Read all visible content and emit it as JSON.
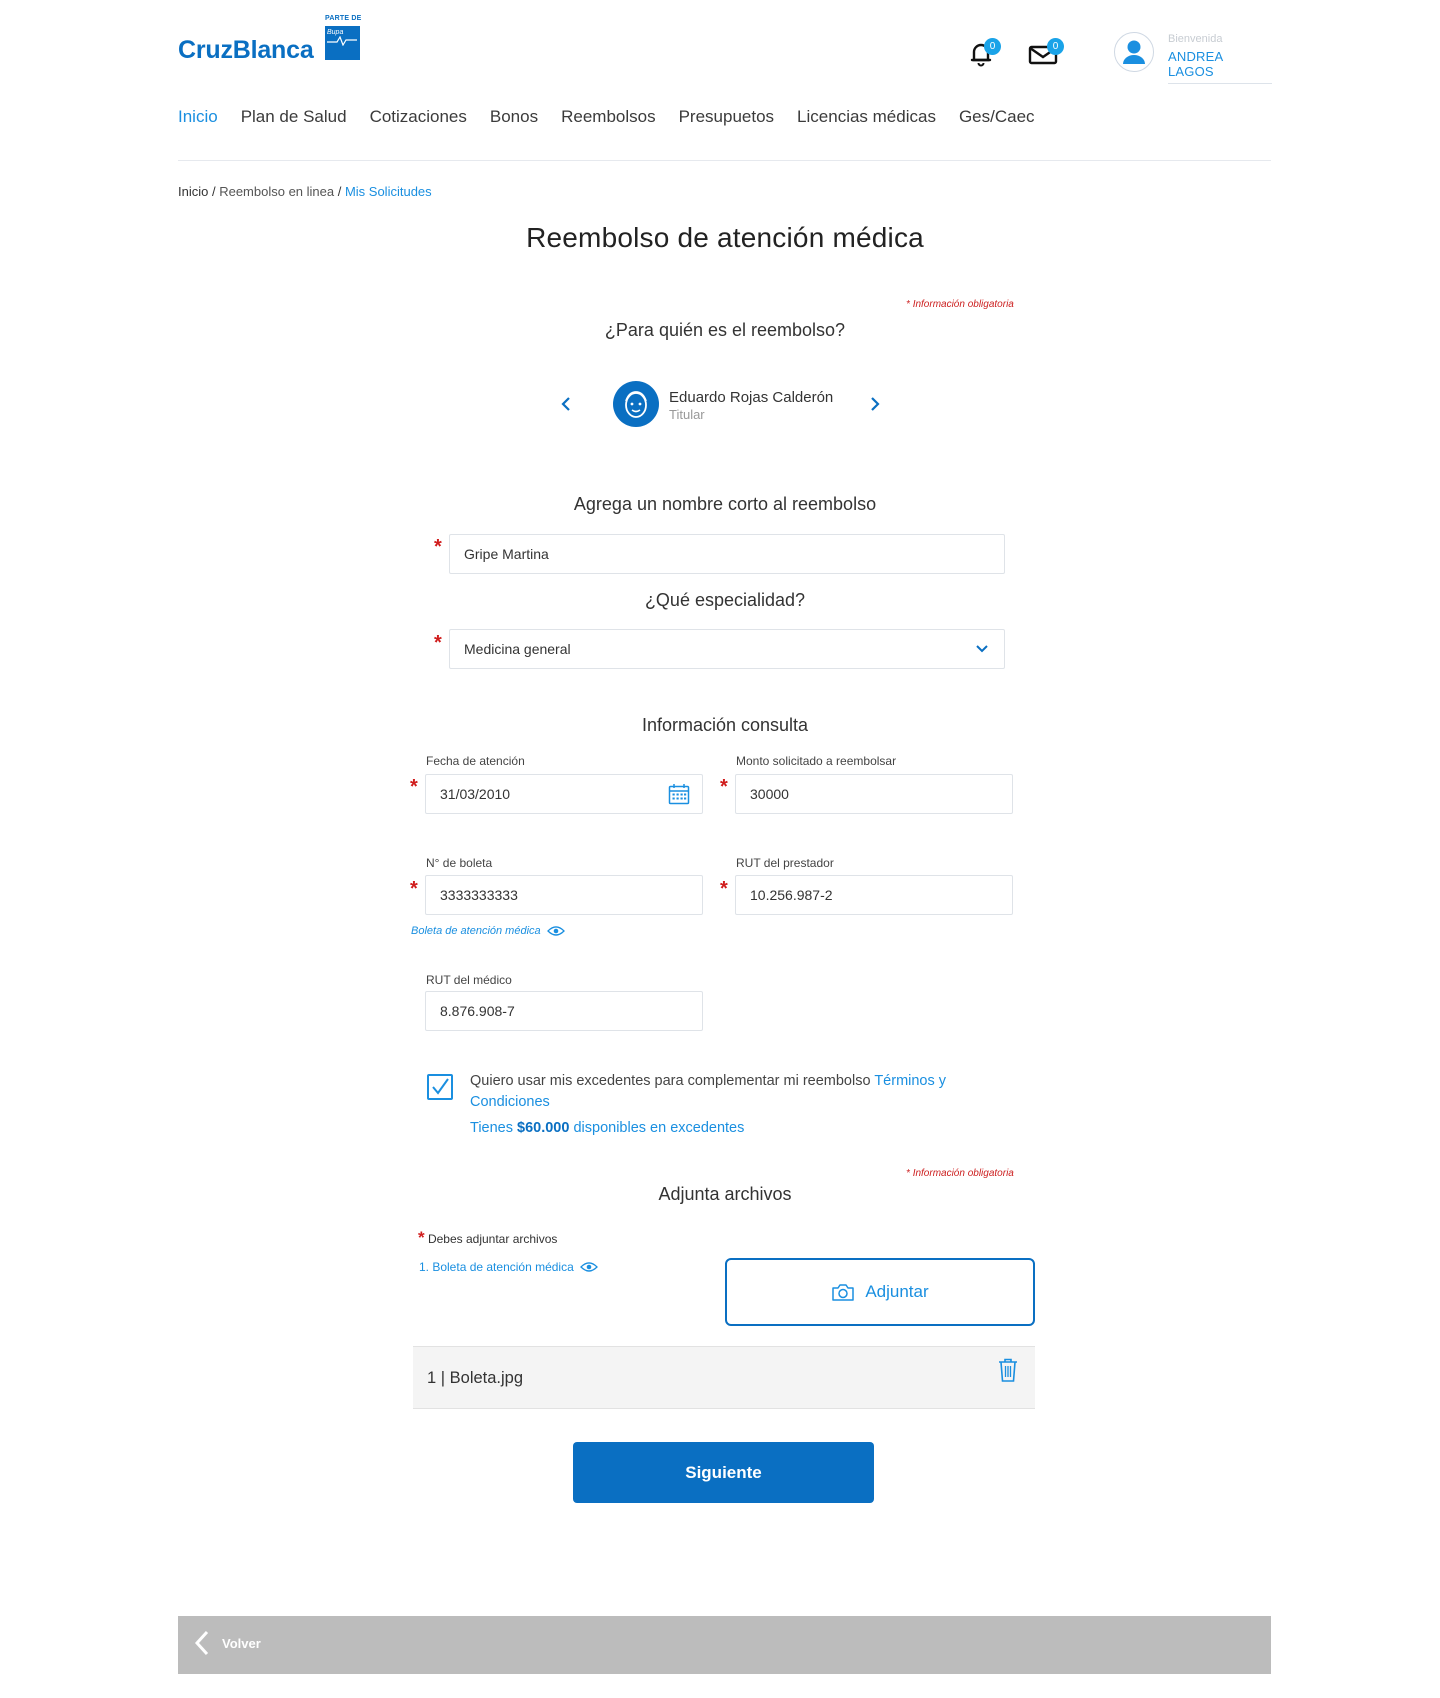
{
  "brand": {
    "logo_text": "CruzBlanca",
    "parte_de": "PARTE DE",
    "bupa": "Bupa"
  },
  "header": {
    "notifications_count": "0",
    "messages_count": "0",
    "welcome": "Bienvenida",
    "user_name": "ANDREA LAGOS"
  },
  "nav": {
    "items": [
      "Inicio",
      "Plan de Salud",
      "Cotizaciones",
      "Bonos",
      "Reembolsos",
      "Presupuetos",
      "Licencias médicas",
      "Ges/Caec"
    ]
  },
  "breadcrumb": {
    "home": "Inicio",
    "sep": " / ",
    "middle": "Reembolso en linea",
    "current": "Mis Solicitudes"
  },
  "page_title": "Reembolso de atención médica",
  "required_note": {
    "asterisk": "*",
    "text": "Información obligatoria"
  },
  "beneficiary": {
    "question": "¿Para quién es el reembolso?",
    "name": "Eduardo Rojas Calderón",
    "role": "Titular"
  },
  "short_name": {
    "title": "Agrega un nombre corto al reembolso",
    "value": "Gripe Martina"
  },
  "specialty": {
    "title": "¿Qué especialidad?",
    "value": "Medicina general"
  },
  "consulta": {
    "title": "Información consulta",
    "fecha_label": "Fecha de atención",
    "fecha_value": "31/03/2010",
    "monto_label": "Monto solicitado a reembolsar",
    "monto_value": "30000",
    "boleta_label": "N° de boleta",
    "boleta_value": "3333333333",
    "boleta_link": "Boleta de atención médica",
    "rut_prestador_label": "RUT del prestador",
    "rut_prestador_value": "10.256.987-2",
    "rut_medico_label": "RUT del médico",
    "rut_medico_value": "8.876.908-7"
  },
  "excedentes": {
    "checkbox_text": "Quiero usar mis excedentes para complementar mi reembolso ",
    "terms_link": "Términos y Condiciones",
    "available_prefix": "Tienes ",
    "available_amount": "$60.000",
    "available_suffix": " disponibles en excedentes",
    "checked": true
  },
  "attachments": {
    "title": "Adjunta archivos",
    "must_attach": "Debes adjuntar archivos",
    "item_link": "1. Boleta de atención médica",
    "button": "Adjuntar",
    "file": "1 | Boleta.jpg"
  },
  "actions": {
    "next": "Siguiente",
    "back": "Volver"
  },
  "colors": {
    "primary": "#0a6fc2",
    "link": "#1a8fe0",
    "required": "#d01c1c",
    "footer": "#bcbcbc"
  }
}
